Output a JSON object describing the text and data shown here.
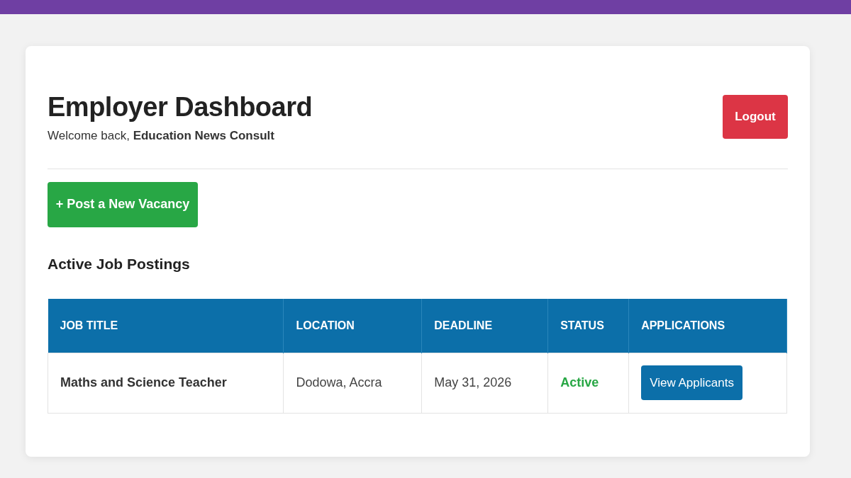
{
  "header": {
    "title": "Employer Dashboard",
    "welcome": "Welcome back, **Education News Consult**",
    "logout": "Logout"
  },
  "post_button": "+ Post a New Vacancy",
  "section_title": "Active Job Postings",
  "table": {
    "columns": [
      "JOB TITLE",
      "LOCATION",
      "DEADLINE",
      "STATUS",
      "APPLICATIONS"
    ],
    "rows": [
      {
        "title": "Maths and Science Teacher",
        "location": "Dodowa, Accra",
        "deadline": "May 31, 2026",
        "status": "Active",
        "active": true,
        "action": "View Applicants"
      }
    ]
  }
}
